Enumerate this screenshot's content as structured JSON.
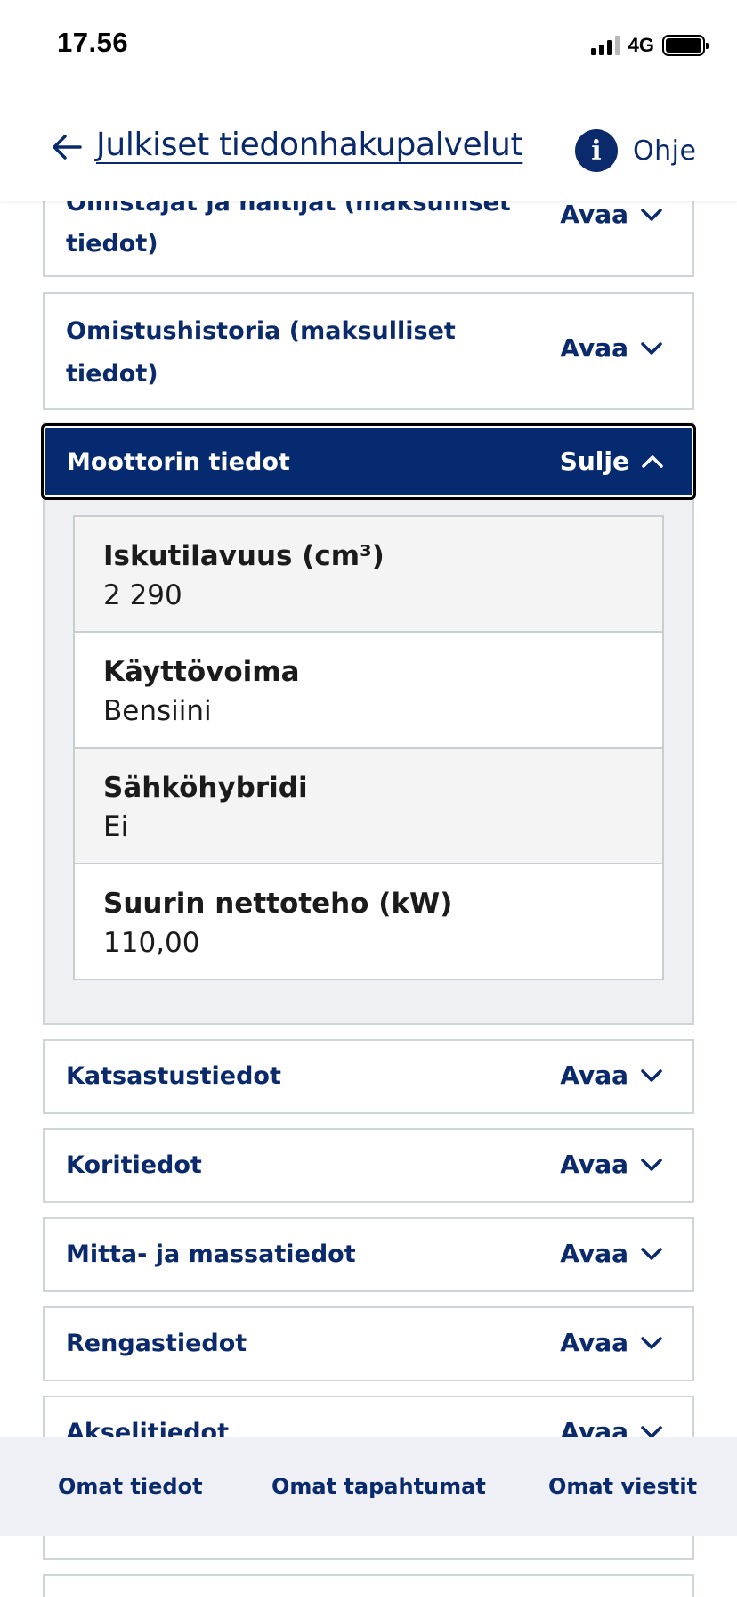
{
  "status_bar": {
    "time": "17.56",
    "network": "4G"
  },
  "header": {
    "back_label": "Julkiset tiedonhakupalvelut",
    "help_label": "Ohje"
  },
  "accordions_top": [
    {
      "title_line1": "Omistajat ja haltijat (maksulliset",
      "title_line2": "tiedot)",
      "toggle": "Avaa"
    },
    {
      "title_line1": "Omistushistoria (maksulliset",
      "title_line2": "tiedot)",
      "toggle": "Avaa"
    }
  ],
  "open_section": {
    "title": "Moottorin tiedot",
    "toggle": "Sulje",
    "rows": [
      {
        "label": "Iskutilavuus (cm³)",
        "value": "2 290"
      },
      {
        "label": "Käyttövoima",
        "value": "Bensiini"
      },
      {
        "label": "Sähköhybridi",
        "value": "Ei"
      },
      {
        "label": "Suurin nettoteho (kW)",
        "value": "110,00"
      }
    ]
  },
  "accordions_bottom": [
    {
      "title": "Katsastustiedot",
      "toggle": "Avaa"
    },
    {
      "title": "Koritiedot",
      "toggle": "Avaa"
    },
    {
      "title": "Mitta- ja massatiedot",
      "toggle": "Avaa"
    },
    {
      "title": "Rengastiedot",
      "toggle": "Avaa"
    },
    {
      "title": "Akselitiedot",
      "toggle": "Avaa"
    }
  ],
  "bottom_nav": [
    "Omat tiedot",
    "Omat tapahtumat",
    "Omat viestit"
  ],
  "colors": {
    "brand_navy": "#0a2a6b",
    "open_header_bg": "#062a70",
    "panel_bg": "#eef0f4"
  }
}
